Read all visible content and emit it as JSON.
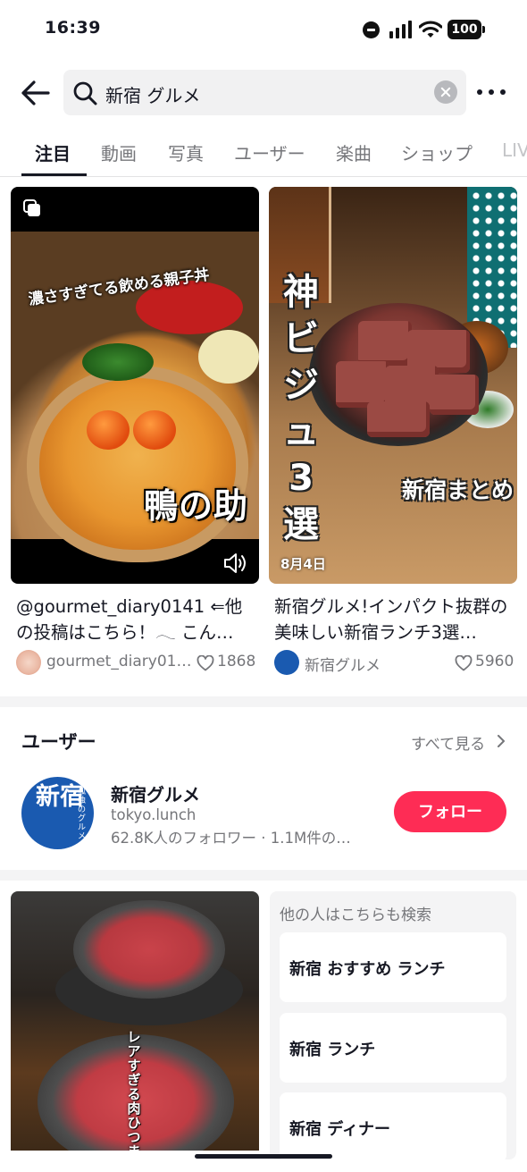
{
  "status_bar": {
    "time": "16:39",
    "battery": "100"
  },
  "search": {
    "query": "新宿 グルメ"
  },
  "tabs": [
    {
      "label": "注目",
      "active": true
    },
    {
      "label": "動画",
      "active": false
    },
    {
      "label": "写真",
      "active": false
    },
    {
      "label": "ユーザー",
      "active": false
    },
    {
      "label": "楽曲",
      "active": false
    },
    {
      "label": "ショップ",
      "active": false
    },
    {
      "label": "LIVE",
      "active": false
    }
  ],
  "videos": [
    {
      "overlay_caption": "濃さすぎてる飲める親子丼",
      "overlay_brand": "鴨の助",
      "title": "@gourmet_diary0141 ⇐他の投稿はこちら！𓂃 こん…",
      "author": "gourmet_diary01…",
      "likes": "1868"
    },
    {
      "overlay_vertical": "神ビジュ3選",
      "overlay_sub": "新宿まとめ",
      "date": "8月4日",
      "title": "新宿グルメ!インパクト抜群の美味しい新宿ランチ3選…",
      "author": "新宿グルメ",
      "likes": "5960"
    }
  ],
  "users_section": {
    "heading": "ユーザー",
    "see_all": "すべて見る",
    "user": {
      "display_name": "新宿グルメ",
      "handle": "tokyo.lunch",
      "stats": "62.8K人のフォロワー · 1.1M件の…",
      "avatar_big": "新宿",
      "avatar_small": "孤独のグルメ",
      "follow_label": "フォロー"
    }
  },
  "bottom_video": {
    "overlay_vertical": "レアすぎる肉ひつま"
  },
  "related_searches": {
    "heading": "他の人はこちらも検索",
    "items": [
      "新宿 おすすめ ランチ",
      "新宿 ランチ",
      "新宿 ディナー"
    ]
  },
  "colors": {
    "accent": "#fe2c55",
    "text_primary": "#161823",
    "text_secondary": "#75767a"
  }
}
